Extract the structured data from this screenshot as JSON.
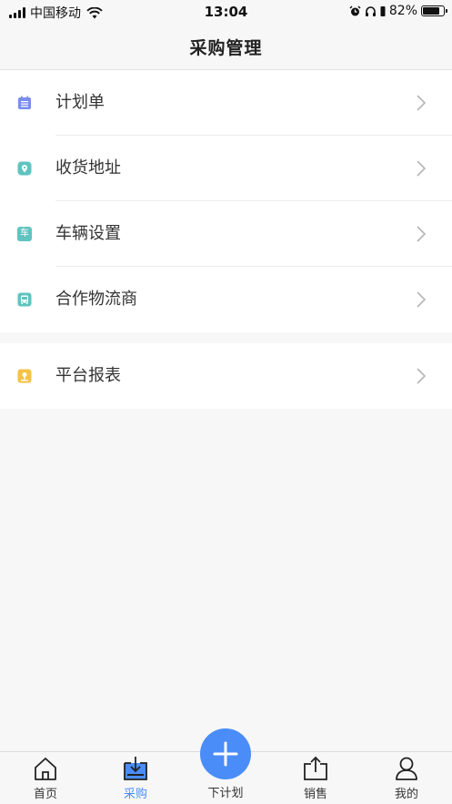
{
  "status_bar": {
    "carrier": "中国移动",
    "time": "13:04",
    "battery": "82%",
    "battery_level": 0.82
  },
  "nav": {
    "title": "采购管理"
  },
  "menu_group_1": [
    {
      "label": "计划单",
      "icon": "list-icon",
      "color": "#7b8cf0"
    },
    {
      "label": "收货地址",
      "icon": "location-pin-icon",
      "color": "#5fc4c0"
    },
    {
      "label": "车辆设置",
      "icon": "vehicle-icon",
      "icon_text": "车",
      "color": "#5fc4c0"
    },
    {
      "label": "合作物流商",
      "icon": "bus-icon",
      "color": "#5fc4c0"
    }
  ],
  "menu_group_2": [
    {
      "label": "平台报表",
      "icon": "report-icon",
      "color": "#f5c344"
    }
  ],
  "tab_bar": {
    "tabs": [
      {
        "label": "首页",
        "icon": "home-icon"
      },
      {
        "label": "采购",
        "icon": "purchase-icon",
        "active": true
      },
      {
        "label": "销售",
        "icon": "sales-icon"
      },
      {
        "label": "我的",
        "icon": "profile-icon"
      }
    ],
    "center": {
      "label": "下计划",
      "icon": "plus-icon"
    },
    "accent": "#4a8df8"
  }
}
